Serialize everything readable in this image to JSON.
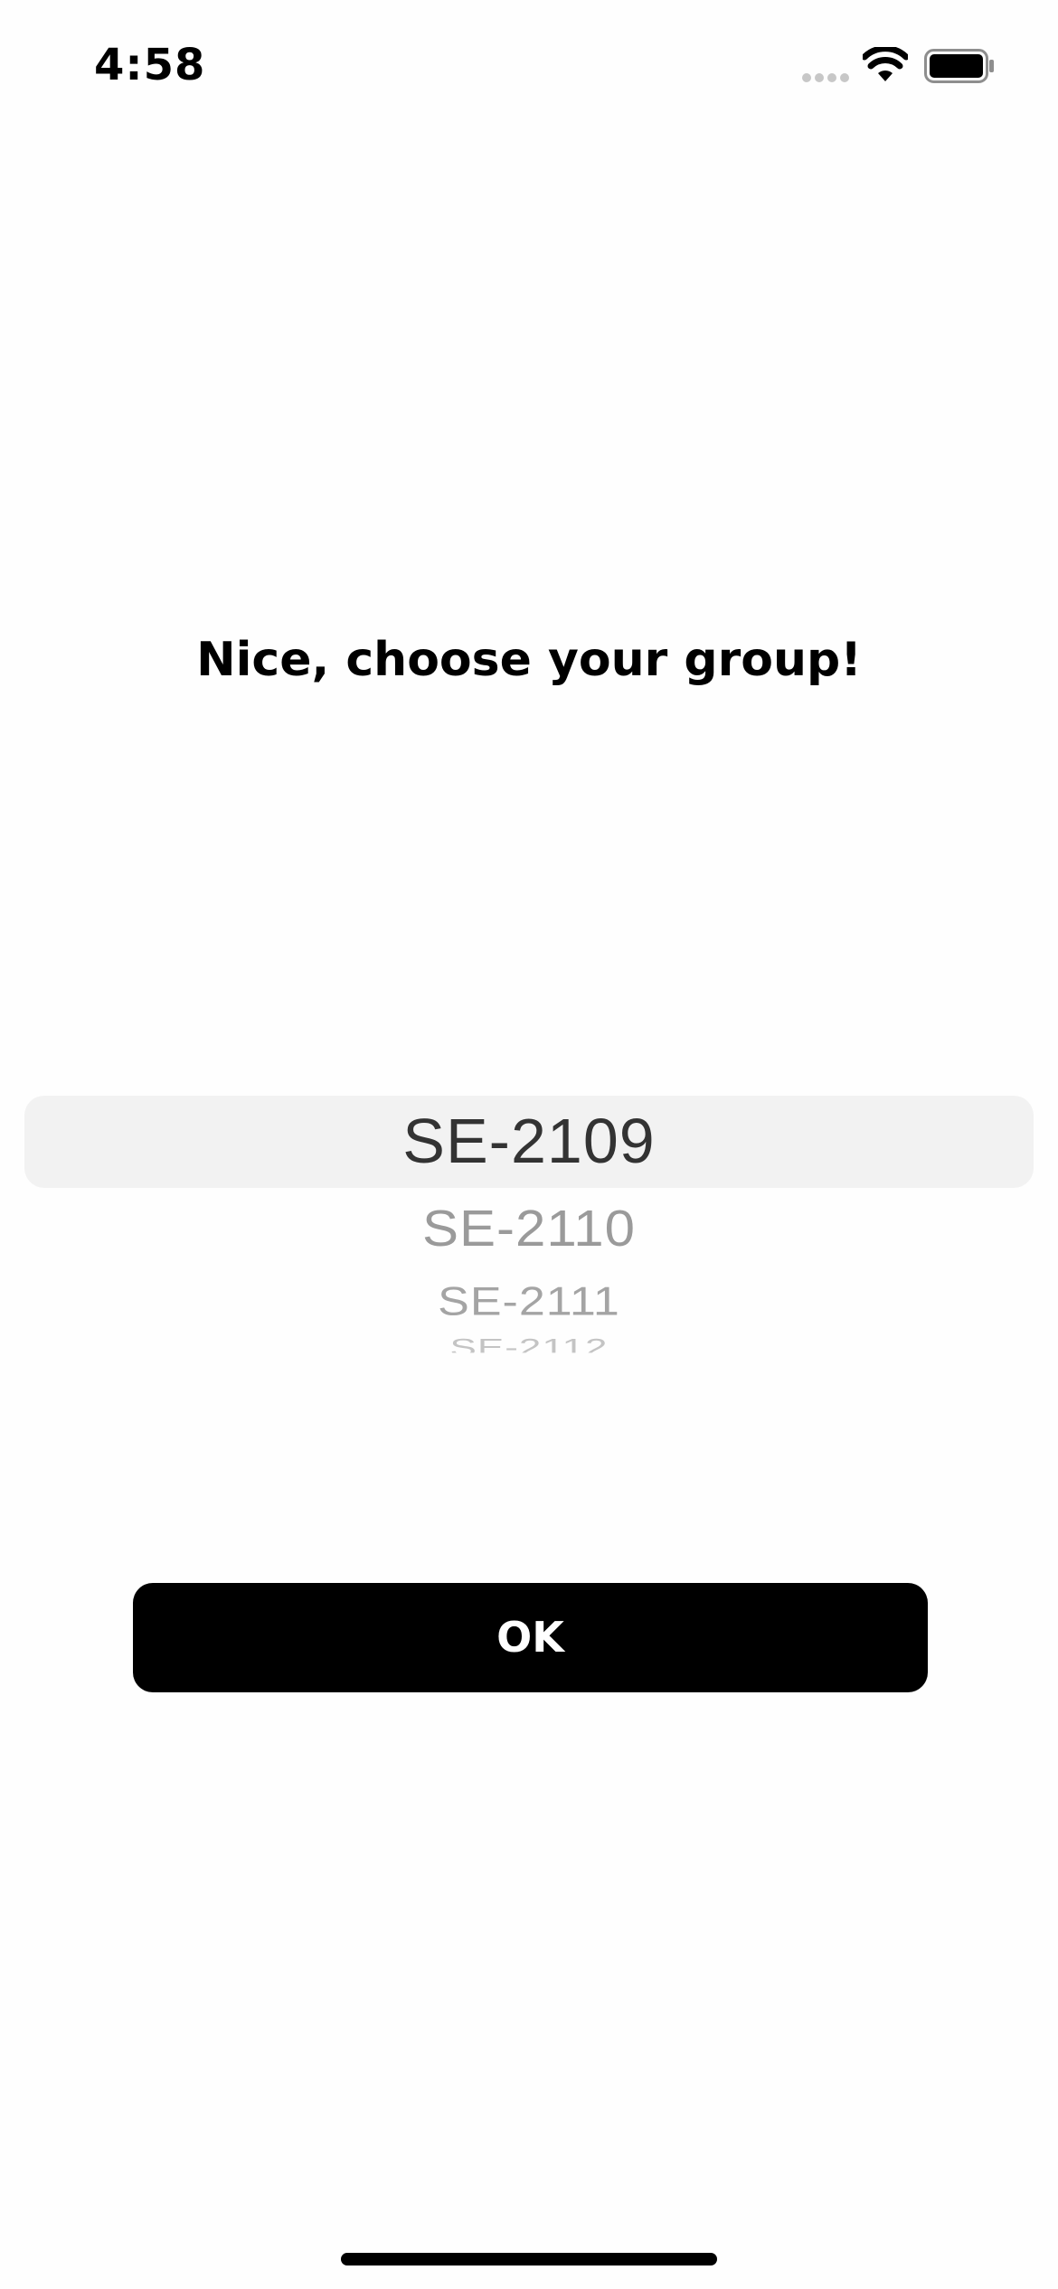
{
  "status_bar": {
    "time": "4:58",
    "icons": [
      "cellular-signal-icon",
      "wifi-icon",
      "battery-icon"
    ]
  },
  "onboarding": {
    "headline": "Nice, choose your group!"
  },
  "group_picker": {
    "selected": "SE-2109",
    "visible_options": [
      "SE-2109",
      "SE-2110",
      "SE-2111",
      "SE-2112"
    ]
  },
  "actions": {
    "ok_label": "OK"
  },
  "colors": {
    "button_background": "#000000",
    "button_text": "#ffffff",
    "picker_highlight": "#f2f2f2",
    "background": "#fefefe"
  }
}
